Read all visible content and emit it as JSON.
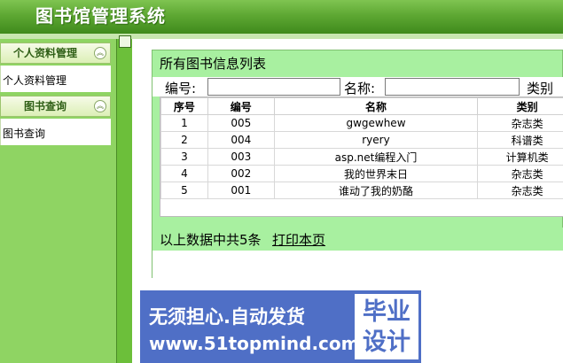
{
  "app": {
    "title": "图书馆管理系统"
  },
  "sidebar": {
    "sections": [
      {
        "label": "个人资料管理",
        "items": [
          "个人资料管理"
        ]
      },
      {
        "label": "图书查询",
        "items": [
          "图书查询"
        ]
      }
    ]
  },
  "main": {
    "panel_title": "所有图书信息列表",
    "search": {
      "number_label": "编号:",
      "number_value": "",
      "name_label": "名称:",
      "name_value": "",
      "category_label": "类别"
    },
    "table": {
      "columns": [
        "序号",
        "编号",
        "名称",
        "类别"
      ],
      "rows": [
        [
          "1",
          "005",
          "gwgewhew",
          "杂志类"
        ],
        [
          "2",
          "004",
          "ryery",
          "科谱类"
        ],
        [
          "3",
          "003",
          "asp.net编程入门",
          "计算机类"
        ],
        [
          "4",
          "002",
          "我的世界末日",
          "杂志类"
        ],
        [
          "5",
          "001",
          "谁动了我的奶酪",
          "杂志类"
        ]
      ]
    },
    "footer": {
      "count_text": "以上数据中共5条",
      "print_label": "打印本页"
    }
  },
  "banner": {
    "line1": "无须担心.自动发货",
    "line2": "www.51topmind.com",
    "badge_line1": "毕业",
    "badge_line2": "设计"
  }
}
